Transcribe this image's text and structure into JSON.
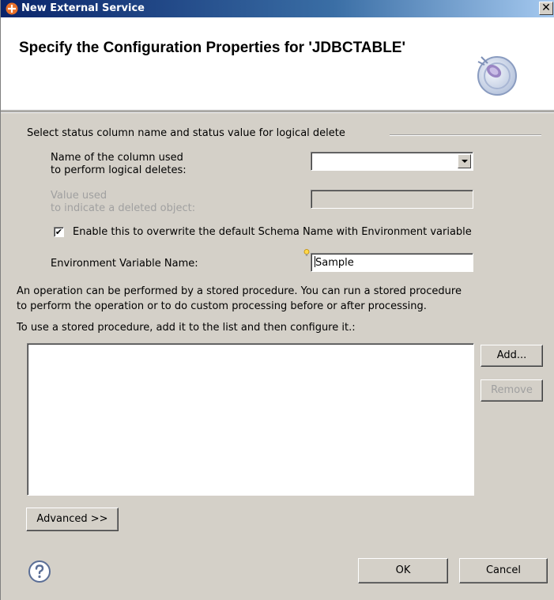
{
  "window": {
    "title": "New External Service",
    "close_label": "✕"
  },
  "banner": {
    "title": "Specify the Configuration Properties for 'JDBCTABLE'"
  },
  "logical_delete": {
    "group_title": "Select status column name and status value for logical delete",
    "column_label_line1": "Name of the column used",
    "column_label_line2": "to perform logical deletes:",
    "column_value": "",
    "value_label_line1": "Value used",
    "value_label_line2": "to indicate a deleted object:",
    "value_value": ""
  },
  "env": {
    "checkbox_label": "Enable this to overwrite the default Schema Name with Environment variable",
    "checkbox_checked": true,
    "checkbox_mark": "✔",
    "var_label": "Environment Variable Name:",
    "var_value": "Sample"
  },
  "stored_proc": {
    "info_line1": "An operation can be performed by a stored procedure. You can run a stored procedure",
    "info_line2": "to perform the operation or to do custom processing before or after processing.",
    "list_label": "To use a stored procedure, add it to the list and then configure it.:",
    "items": [],
    "add_label": "Add...",
    "remove_label": "Remove"
  },
  "footer": {
    "advanced_label": "Advanced >>",
    "ok_label": "OK",
    "cancel_label": "Cancel"
  }
}
